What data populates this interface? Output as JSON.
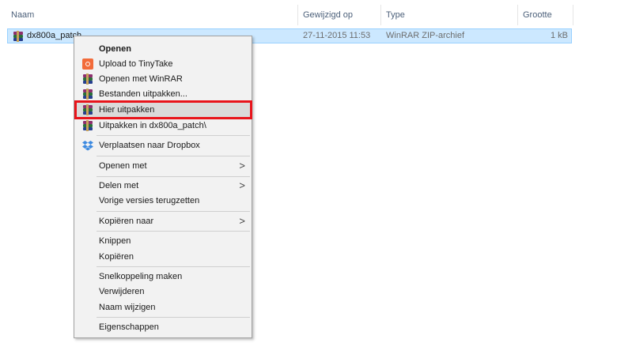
{
  "columns": {
    "name": "Naam",
    "modified": "Gewijzigd op",
    "type": "Type",
    "size": "Grootte"
  },
  "file": {
    "name": "dx800a_patch",
    "modified": "27-11-2015 11:53",
    "type": "WinRAR ZIP-archief",
    "size": "1 kB",
    "icon": "winrar-archive-icon"
  },
  "menu": {
    "items": [
      {
        "label": "Openen",
        "bold": true
      },
      {
        "label": "Upload to TinyTake",
        "icon": "tinytake-icon"
      },
      {
        "label": "Openen met WinRAR",
        "icon": "winrar-icon"
      },
      {
        "label": "Bestanden uitpakken...",
        "icon": "winrar-icon"
      },
      {
        "label": "Hier uitpakken",
        "icon": "winrar-icon",
        "highlighted": true
      },
      {
        "label": "Uitpakken in dx800a_patch\\",
        "icon": "winrar-icon"
      },
      {
        "label": "Verplaatsen naar Dropbox",
        "icon": "dropbox-icon"
      },
      {
        "label": "Openen met",
        "submenu": true
      },
      {
        "label": "Delen met",
        "submenu": true
      },
      {
        "label": "Vorige versies terugzetten"
      },
      {
        "label": "Kopiëren naar",
        "submenu": true
      },
      {
        "label": "Knippen"
      },
      {
        "label": "Kopiëren"
      },
      {
        "label": "Snelkoppeling maken"
      },
      {
        "label": "Verwijderen"
      },
      {
        "label": "Naam wijzigen"
      },
      {
        "label": "Eigenschappen"
      }
    ],
    "submenu_arrow": ">"
  },
  "colors": {
    "selection": "#cce8ff",
    "highlight_box": "#e8141b"
  }
}
